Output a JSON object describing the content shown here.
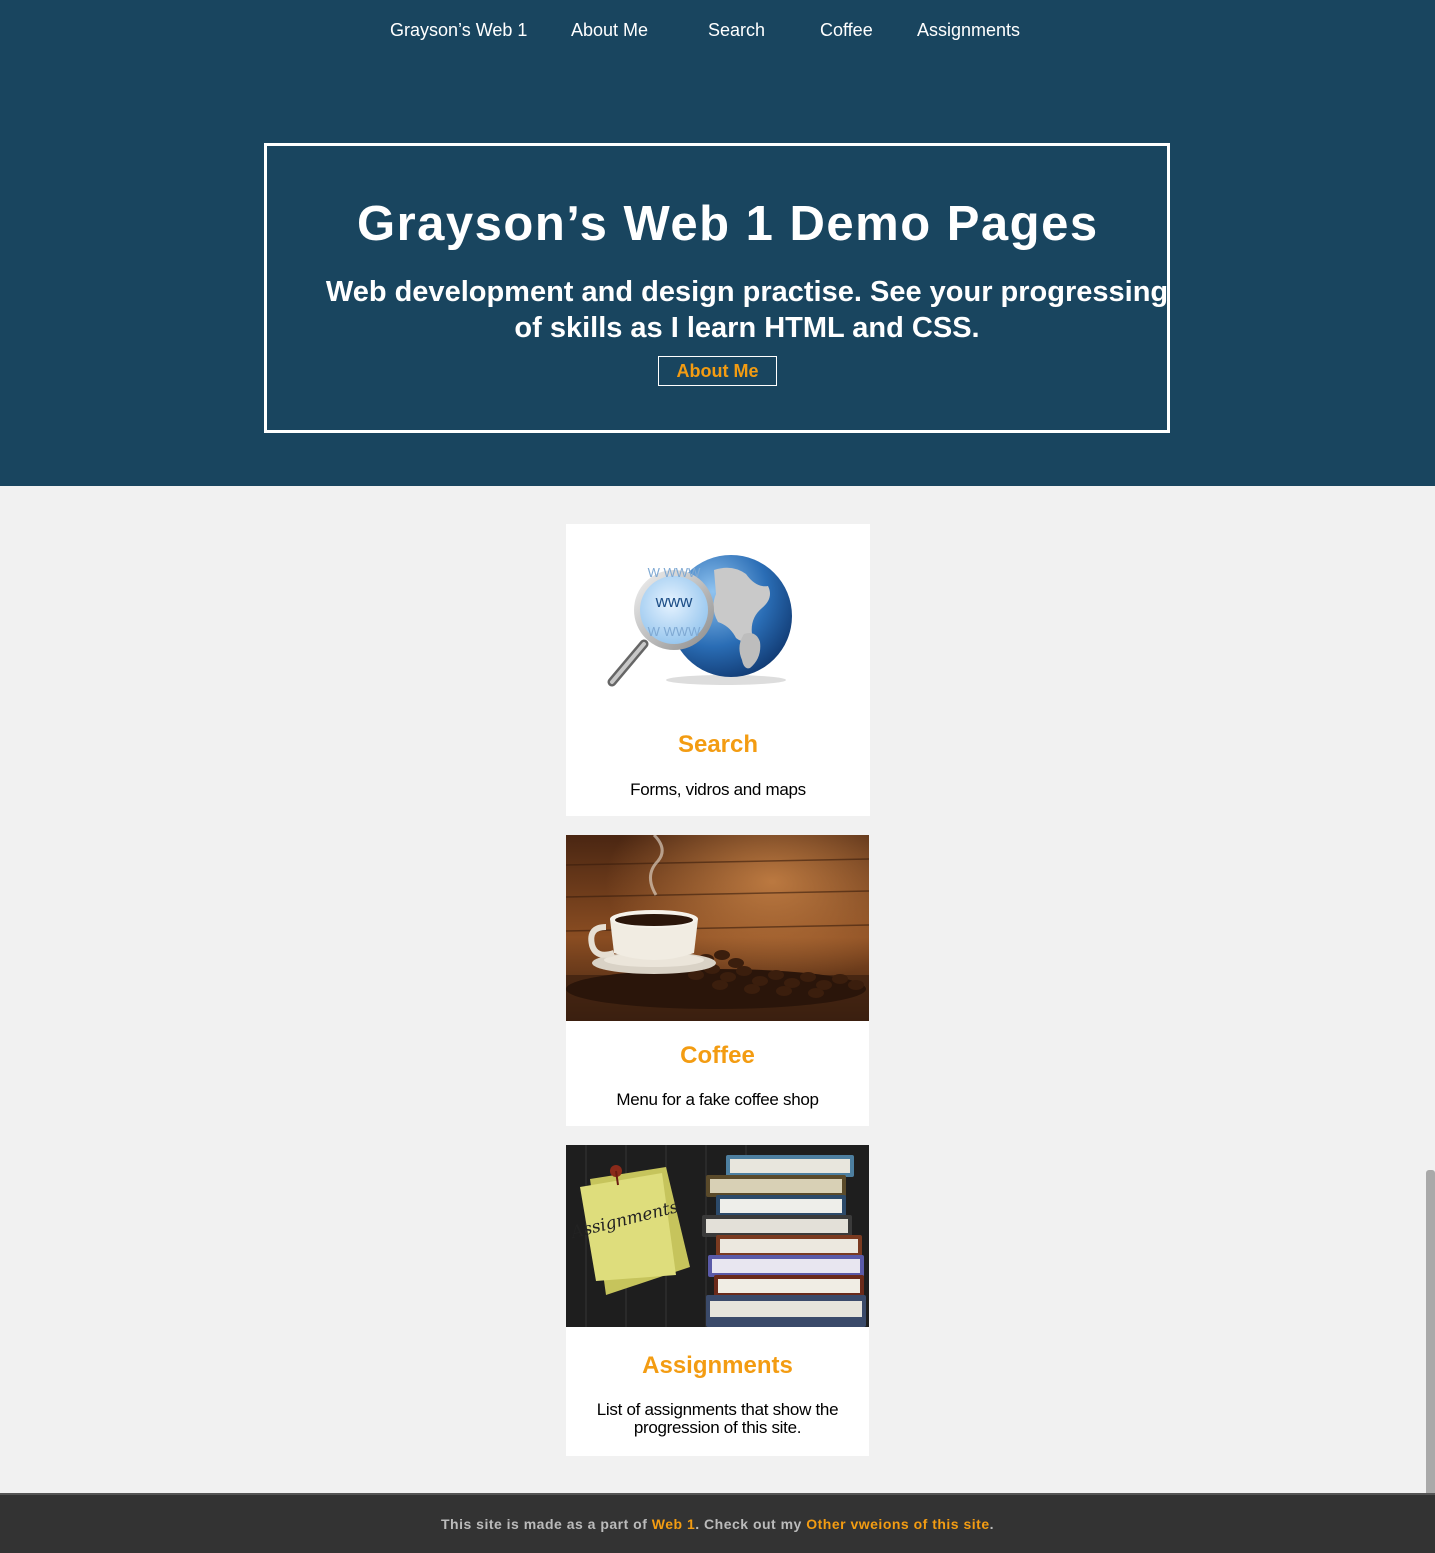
{
  "nav": {
    "brand": "Grayson’s Web 1",
    "about": "About Me",
    "search": "Search",
    "coffee": "Coffee",
    "assignments": "Assignments"
  },
  "hero": {
    "title": "Grayson’s Web 1 Demo Pages",
    "subtitle": "Web development and design practise. See your progressing of skills as I learn HTML and CSS.",
    "button": "About Me"
  },
  "cards": [
    {
      "title": "Search",
      "description": "Forms, vidros and maps",
      "image": "globe-magnifier"
    },
    {
      "title": "Coffee",
      "description": "Menu for a fake coffee shop",
      "image": "coffee-cup"
    },
    {
      "title": "Assignments",
      "description": "List of assignments that show the progression of this site.",
      "image": "sticky-note-books"
    }
  ],
  "footer": {
    "prefix": "This site is made as a part of ",
    "link1": "Web 1",
    "middle": ". Check out my ",
    "link2": "Other vweions of this site",
    "suffix": "."
  },
  "colors": {
    "header_bg": "#19455f",
    "accent": "#f39c12",
    "page_bg": "#f1f1f1",
    "footer_bg": "#333333"
  }
}
